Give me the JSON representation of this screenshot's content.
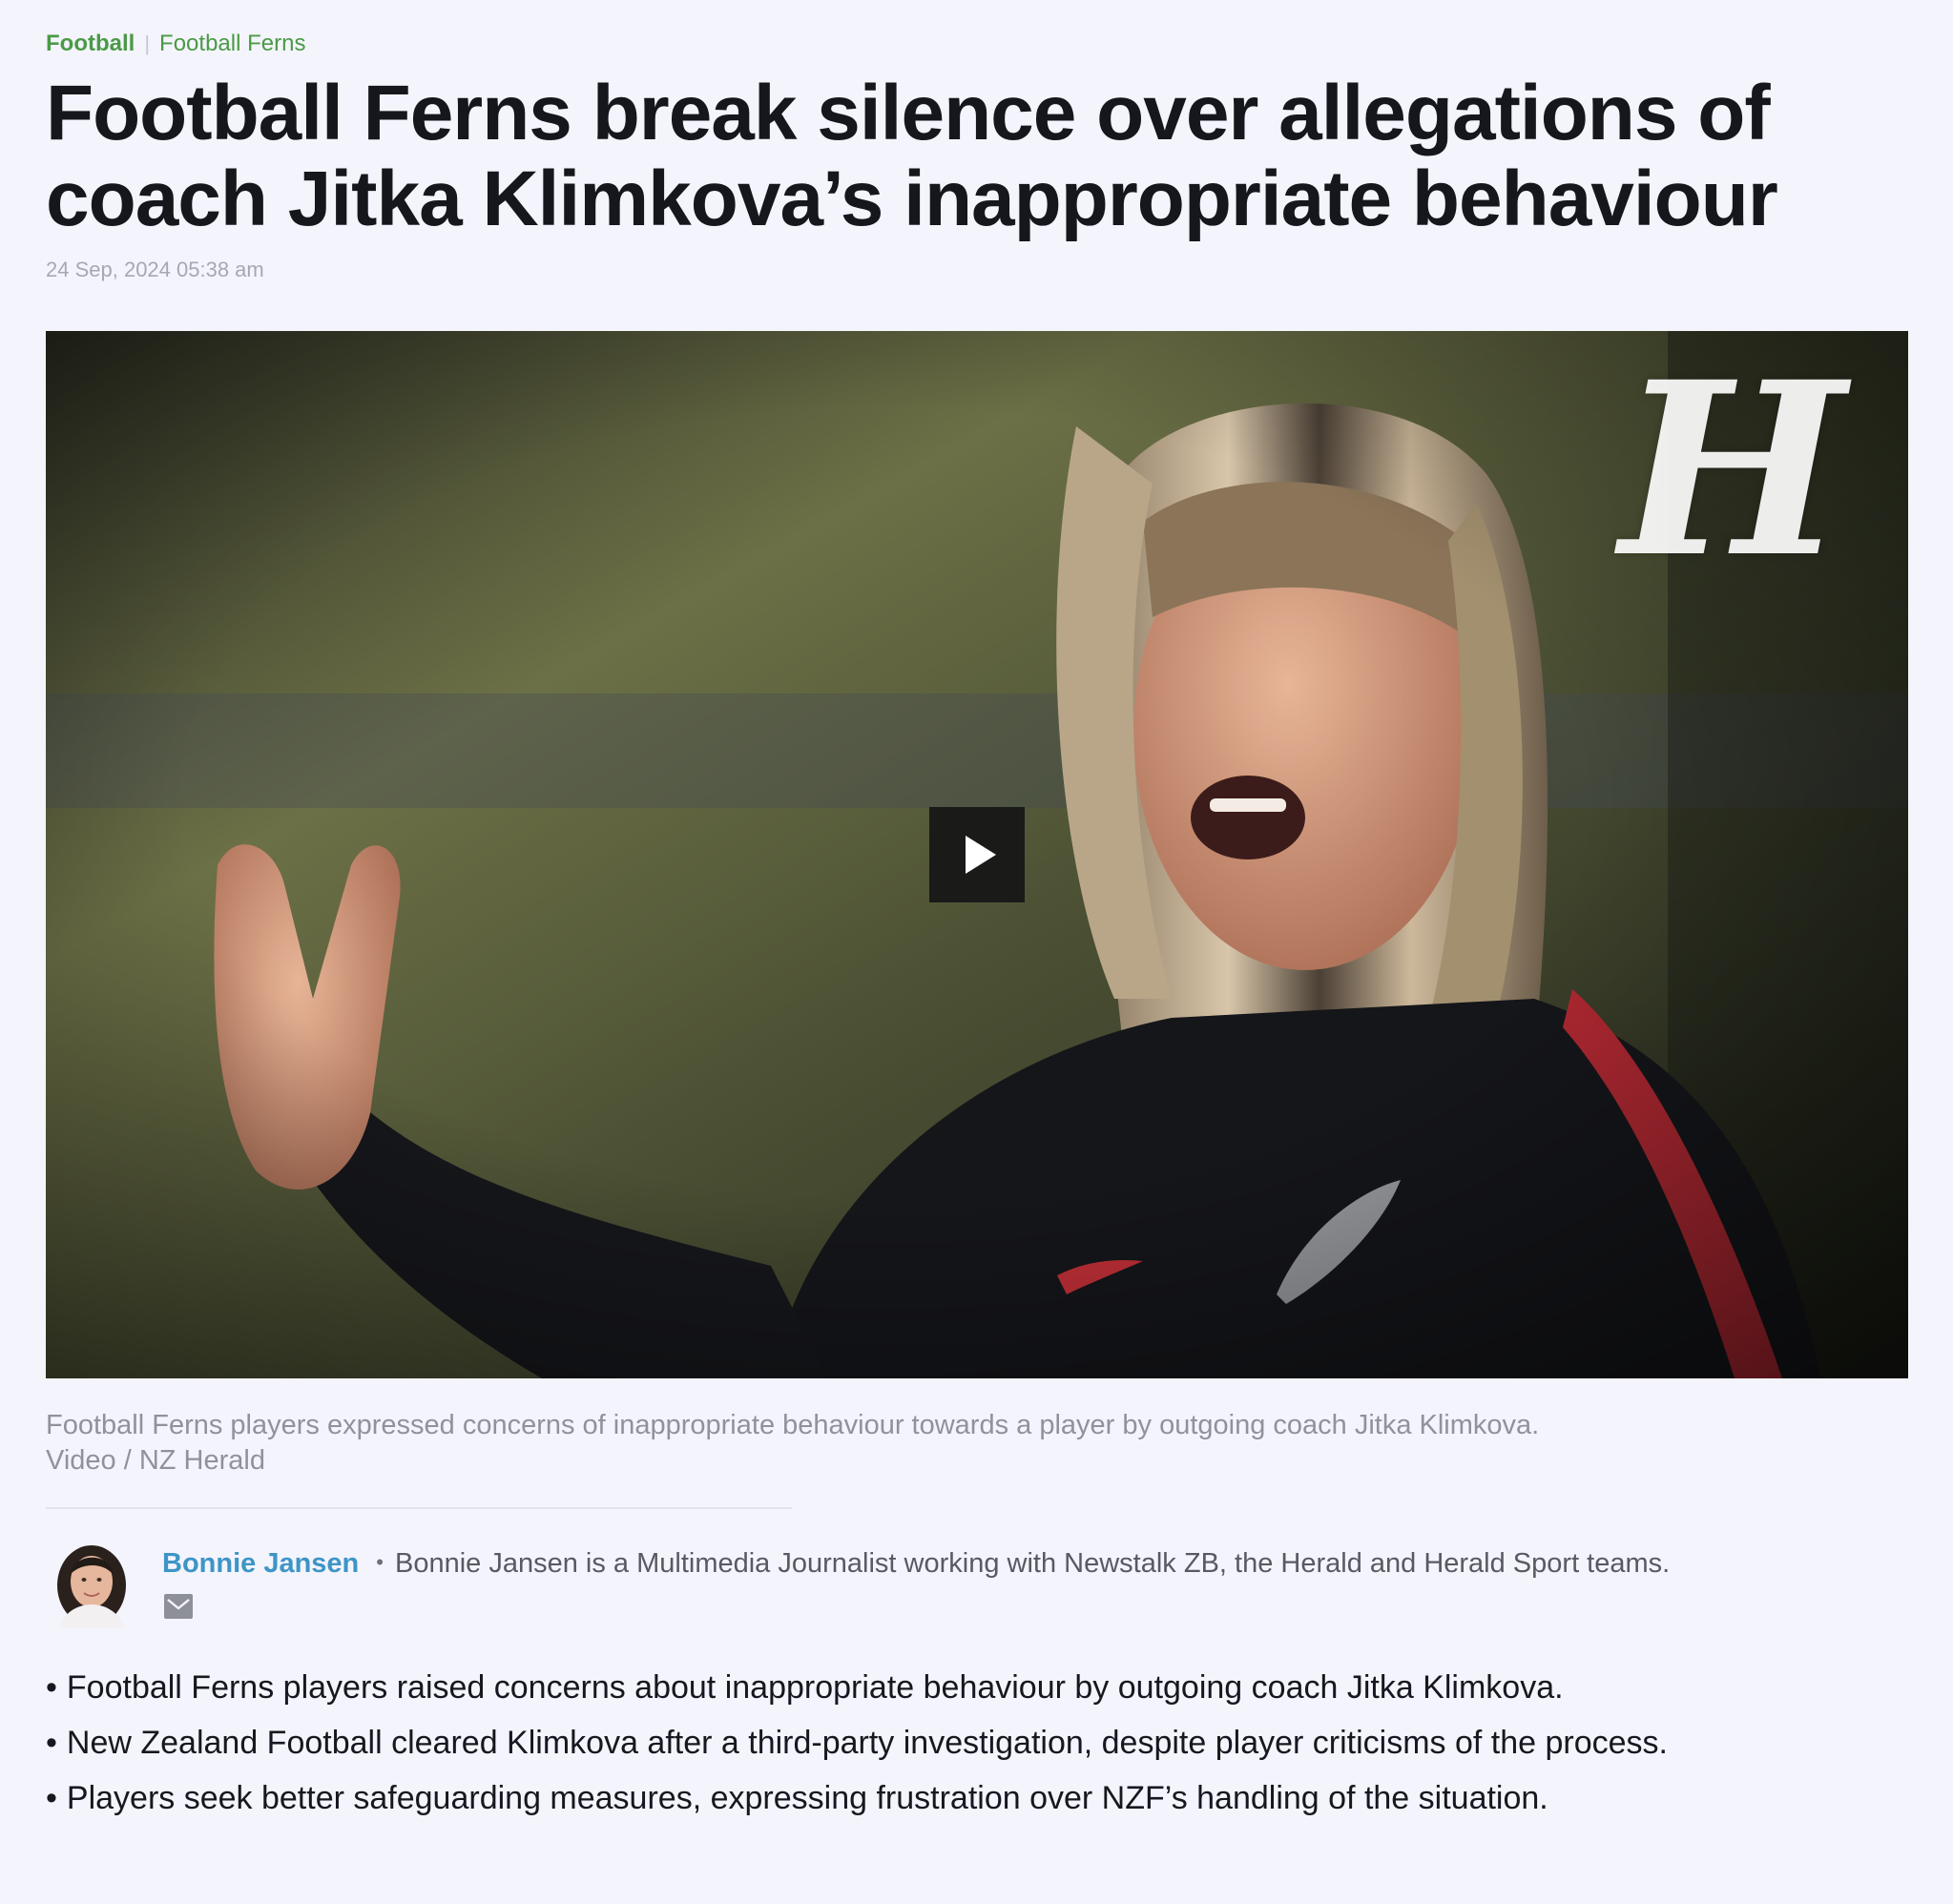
{
  "breadcrumb": {
    "primary": "Football",
    "separator": "|",
    "secondary": "Football Ferns"
  },
  "article": {
    "headline_line1": "Football Ferns break silence over allegations of",
    "headline_line2": "coach Jitka Klimkova’s inappropriate behaviour",
    "timestamp": "24 Sep, 2024 05:38 am"
  },
  "media": {
    "watermark": "H",
    "play_icon": "play-icon",
    "caption_line1": "Football Ferns players expressed concerns of inappropriate behaviour towards a player by outgoing coach Jitka Klimkova.",
    "caption_line2": "Video / NZ Herald"
  },
  "author": {
    "name": "Bonnie Jansen",
    "separator": "•",
    "bio": "Bonnie Jansen is a Multimedia Journalist working with Newstalk ZB, the Herald and Herald Sport teams.",
    "contact_icon": "mail-icon"
  },
  "summary": {
    "bullet": "•",
    "items": [
      "Football Ferns players raised concerns about inappropriate behaviour by outgoing coach Jitka Klimkova.",
      "New Zealand Football cleared Klimkova after a third-party investigation, despite player criticisms of the process.",
      "Players seek better safeguarding measures, expressing frustration over NZF’s handling of the situation."
    ]
  },
  "colors": {
    "background": "#f4f4fd",
    "breadcrumb": "#4a9a46",
    "author_name": "#3d95c6",
    "headline": "#15171d",
    "caption": "#8f929c"
  }
}
